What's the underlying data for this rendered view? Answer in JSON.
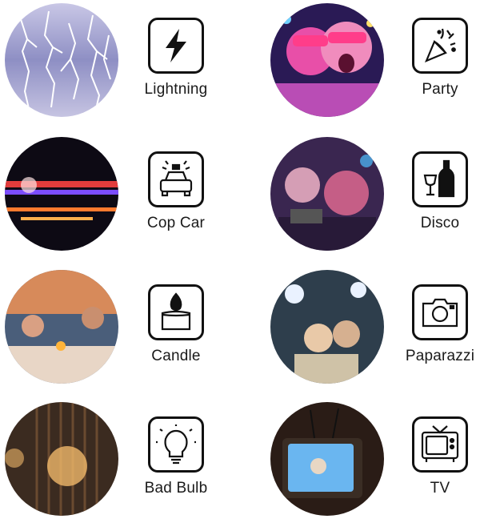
{
  "modes": [
    {
      "id": "lightning",
      "label": "Lightning",
      "icon": "lightning-bolt-icon"
    },
    {
      "id": "party",
      "label": "Party",
      "icon": "party-popper-icon"
    },
    {
      "id": "cop-car",
      "label": "Cop Car",
      "icon": "police-car-icon"
    },
    {
      "id": "disco",
      "label": "Disco",
      "icon": "wine-bottle-glass-icon"
    },
    {
      "id": "candle",
      "label": "Candle",
      "icon": "candle-icon"
    },
    {
      "id": "paparazzi",
      "label": "Paparazzi",
      "icon": "camera-icon"
    },
    {
      "id": "bad-bulb",
      "label": "Bad Bulb",
      "icon": "light-bulb-icon"
    },
    {
      "id": "tv",
      "label": "TV",
      "icon": "retro-tv-icon"
    }
  ]
}
